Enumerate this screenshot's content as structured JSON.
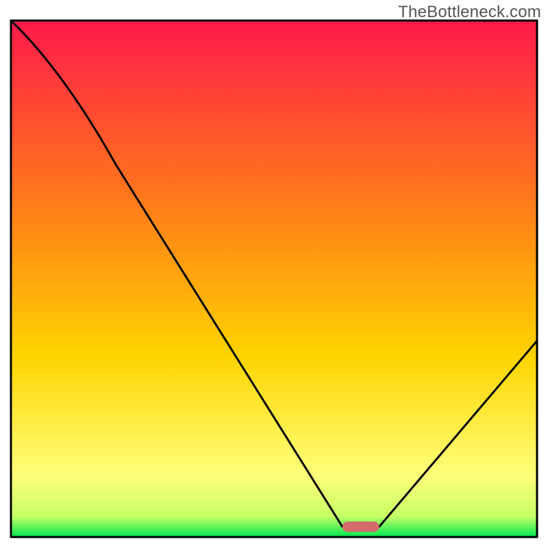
{
  "watermark": "TheBottleneck.com",
  "chart_data": {
    "type": "line",
    "title": "",
    "xlabel": "",
    "ylabel": "",
    "xlim": [
      0,
      100
    ],
    "ylim": [
      0,
      100
    ],
    "x": [
      0,
      20,
      63,
      70,
      100
    ],
    "values": [
      100,
      72,
      2,
      2,
      38
    ],
    "optimal_range_x": [
      63,
      70
    ],
    "background_gradient": {
      "top": "#ff1a4a",
      "mid": "#ffd400",
      "bottom_band": "#ffff7a",
      "base": "#00e851"
    },
    "line_color": "#000000",
    "marker": {
      "shape": "rounded-bar",
      "color": "#d46a6a",
      "x_center": 66.5,
      "y": 2,
      "width_x_units": 7,
      "height_y_units": 2
    },
    "axes": {
      "show_ticks": false,
      "show_grid": false,
      "frame": true,
      "frame_color": "#000000"
    }
  }
}
